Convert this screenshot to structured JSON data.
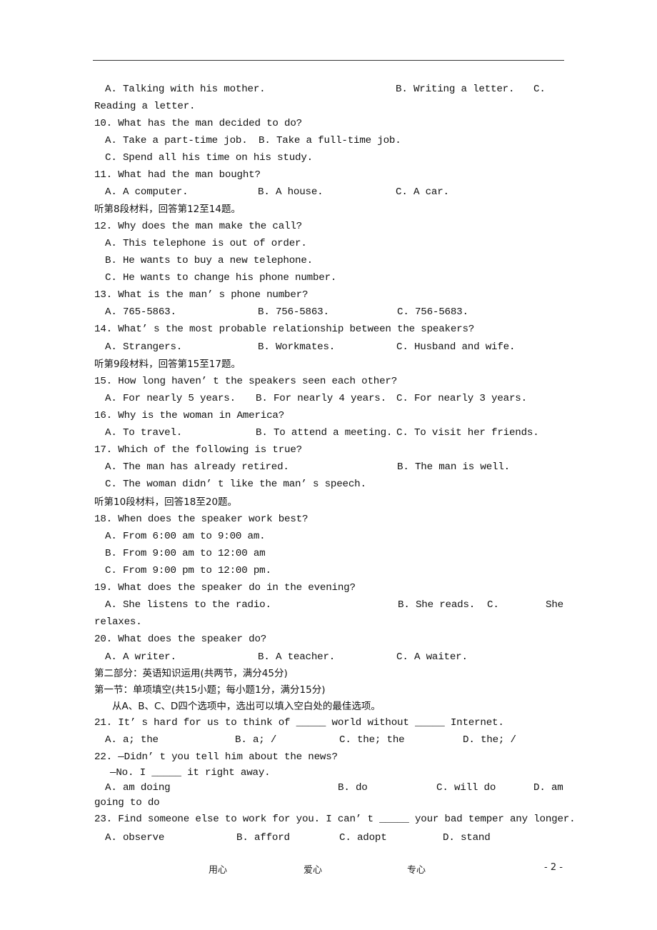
{
  "page": {
    "q9_opts": {
      "a": "A. Talking with his mother.",
      "b": "B. Writing a letter.",
      "c": "C.",
      "c_cont": "Reading a letter."
    },
    "q10": {
      "stem": "10. What has the man decided to do?",
      "a": "A. Take a part-time job.",
      "b": "B. Take a full-time job.",
      "c": "C. Spend all his time on his study."
    },
    "q11": {
      "stem": "11. What had the man bought?",
      "a": "A. A computer.",
      "b": "B. A house.",
      "c": "C. A car."
    },
    "section8": "听第8段材料，回答第12至14题。",
    "q12": {
      "stem": "12. Why does the man make the call?",
      "a": "A. This telephone is out of order.",
      "b": "B. He wants to buy a new telephone.",
      "c": "C. He wants to change his phone number."
    },
    "q13": {
      "stem": "13. What is the man’ s phone number?",
      "a": "A. 765-5863.",
      "b": "B. 756-5863.",
      "c": "C. 756-5683."
    },
    "q14": {
      "stem": "14. What’ s the most probable relationship between the speakers?",
      "a": "A. Strangers.",
      "b": "B. Workmates.",
      "c": "C. Husband and wife."
    },
    "section9": "听第9段材料，回答第15至17题。",
    "q15": {
      "stem": "15. How long haven’ t the speakers seen each other?",
      "a": "A. For nearly 5 years.",
      "b": "B. For nearly 4 years.",
      "c": "C. For nearly 3 years."
    },
    "q16": {
      "stem": "16. Why is the woman in America?",
      "a": "A. To travel.",
      "b": "B. To attend a meeting.",
      "c": "C. To visit her friends."
    },
    "q17": {
      "stem": "17. Which of the following is true?",
      "a": "A. The man has already retired.",
      "b": "B. The man is well.",
      "c": "C. The woman didn’ t like the man’ s speech."
    },
    "section10": "听第10段材料，回答18至20题。",
    "q18": {
      "stem": "18. When does the speaker work best?",
      "a": "A. From 6:00 am to 9:00 am.",
      "b": "B. From 9:00 am to 12:00 am",
      "c": "C. From 9:00 pm to 12:00 pm."
    },
    "q19": {
      "stem": "19. What does the speaker do in the evening?",
      "a": "A. She listens to the radio.",
      "b": "B. She reads.",
      "c": "C.",
      "c_tail": "She",
      "c_cont": "relaxes."
    },
    "q20": {
      "stem": "20. What does the speaker do?",
      "a": "A. A writer.",
      "b": "B. A teacher.",
      "c": "C. A waiter."
    },
    "part2_title": "第二部分：英语知识运用(共两节，满分45分)",
    "part2_sec1": "第一节：单项填空(共15小题；每小题1分，满分15分)",
    "part2_instr": "从A、B、C、D四个选项中，选出可以填入空白处的最佳选项。",
    "q21": {
      "stem": "21. It’ s hard for us to think of _____ world without _____ Internet.",
      "a": "A. a; the",
      "b": "B. a; /",
      "c": "C. the; the",
      "d": "D. the; /"
    },
    "q22": {
      "stem": "22. —Didn’ t you tell him about the news?",
      "stem2": "—No. I _____ it right away.",
      "a": "A. am doing",
      "b": "B. do",
      "c": "C. will do",
      "d": "D. am",
      "d_cont": "going to do"
    },
    "q23": {
      "stem": "23. Find someone else to work for you. I can’ t _____ your bad temper any longer.",
      "a": "A. observe",
      "b": "B. afford",
      "c": "C. adopt",
      "d": "D. stand"
    }
  },
  "footer": {
    "left": "用心",
    "mid": "爱心",
    "right": "专心",
    "page_number": "- 2 -"
  }
}
